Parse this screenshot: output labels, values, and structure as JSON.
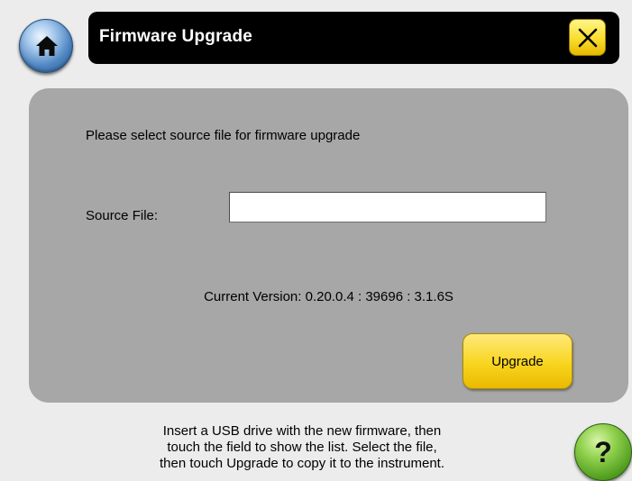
{
  "header": {
    "home_icon": "home-icon",
    "title": "Firmware Upgrade",
    "close_icon": "close-icon",
    "close_color": "#f9dd2c"
  },
  "panel": {
    "prompt": "Please select source file for firmware upgrade",
    "source_label": "Source File:",
    "source_value": "",
    "version_text": "Current Version: 0.20.0.4 : 39696 : 3.1.6S",
    "upgrade_label": "Upgrade",
    "upgrade_color": "#f9d51f"
  },
  "footer": {
    "help_lines": [
      "Insert a USB drive with the new firmware, then",
      "touch the field to show the list. Select the file,",
      "then touch Upgrade to copy it to the instrument."
    ],
    "help_icon": "?",
    "help_color": "#8fd04c"
  }
}
